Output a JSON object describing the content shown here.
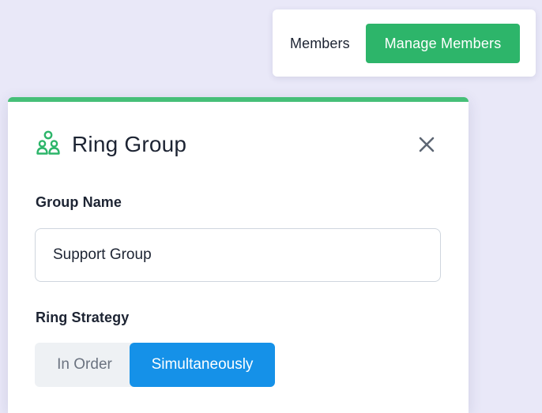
{
  "members_card": {
    "label": "Members",
    "manage_button": "Manage Members"
  },
  "dialog": {
    "title": "Ring Group",
    "icon": "group-icon",
    "close_icon": "close-icon",
    "group_name": {
      "label": "Group Name",
      "value": "Support Group"
    },
    "ring_strategy": {
      "label": "Ring Strategy",
      "options": [
        "In Order",
        "Simultaneously"
      ],
      "selected": "Simultaneously"
    }
  },
  "colors": {
    "accent_green": "#2db56a",
    "dialog_top_border": "#46bf78",
    "selected_blue": "#1591e8",
    "background": "#e9e8f8"
  }
}
